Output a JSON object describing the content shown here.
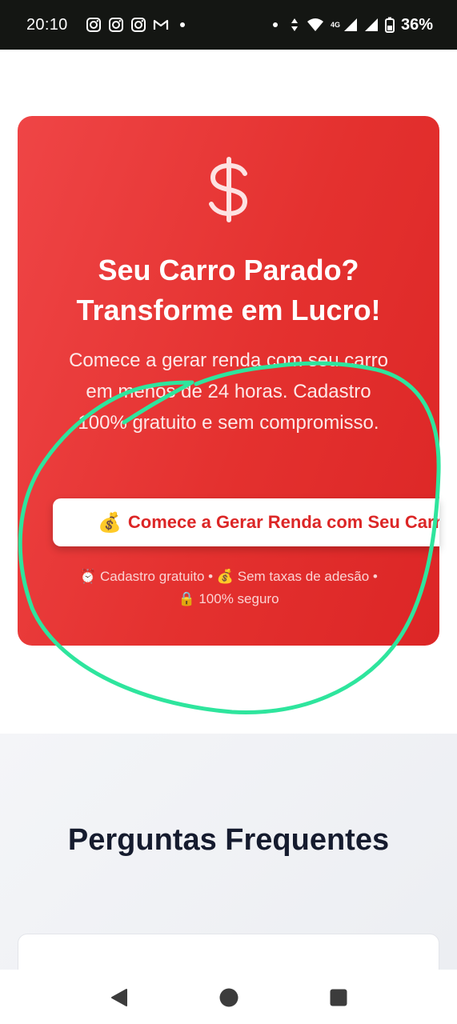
{
  "status_bar": {
    "time": "20:10",
    "app_icons": [
      "instagram-icon",
      "instagram-icon",
      "instagram-icon",
      "gmail-icon"
    ],
    "network": "4G",
    "battery": "36%"
  },
  "hero": {
    "icon": "dollar-icon",
    "title_line1": "Seu Carro Parado?",
    "title_line2": "Transforme em Lucro!",
    "subtitle": "Comece a gerar renda com seu carro em menos de 24 horas. Cadastro 100% gratuito e sem compromisso.",
    "cta": {
      "emoji": "💰",
      "label": "Comece a Gerar Renda com Seu Carro"
    },
    "notes_line1": "⏰ Cadastro gratuito • 💰 Sem taxas de adesão •",
    "notes_line2": "🔒 100% seguro"
  },
  "faq": {
    "title": "Perguntas Frequentes"
  },
  "colors": {
    "hero_red": "#dc2626",
    "annotation_green": "#2ee59d",
    "status_bar_bg": "#141613"
  }
}
